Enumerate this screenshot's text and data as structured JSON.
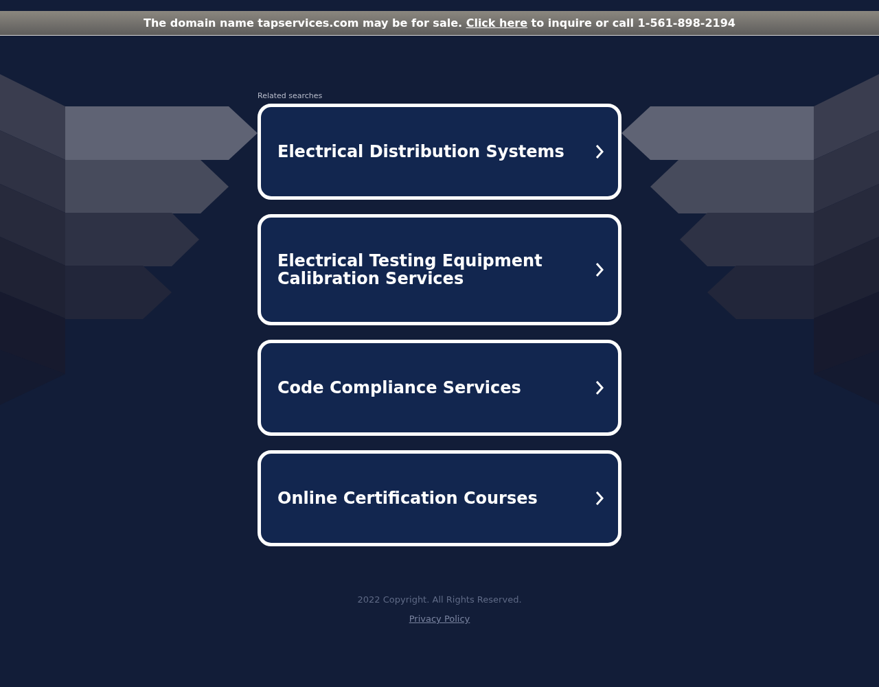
{
  "banner": {
    "text_before": "The domain name tapservices.com may be for sale.",
    "link": "Click here",
    "text_after": "to inquire or call 1-561-898-2194"
  },
  "related": {
    "heading": "Related searches",
    "items": [
      {
        "label": "Electrical Distribution Systems"
      },
      {
        "label": "Electrical Testing Equipment Calibration Services"
      },
      {
        "label": "Code Compliance Services"
      },
      {
        "label": "Online Certification Courses"
      }
    ]
  },
  "footer": {
    "copyright": "2022 Copyright. All Rights Reserved.",
    "privacy_link": "Privacy Policy"
  }
}
